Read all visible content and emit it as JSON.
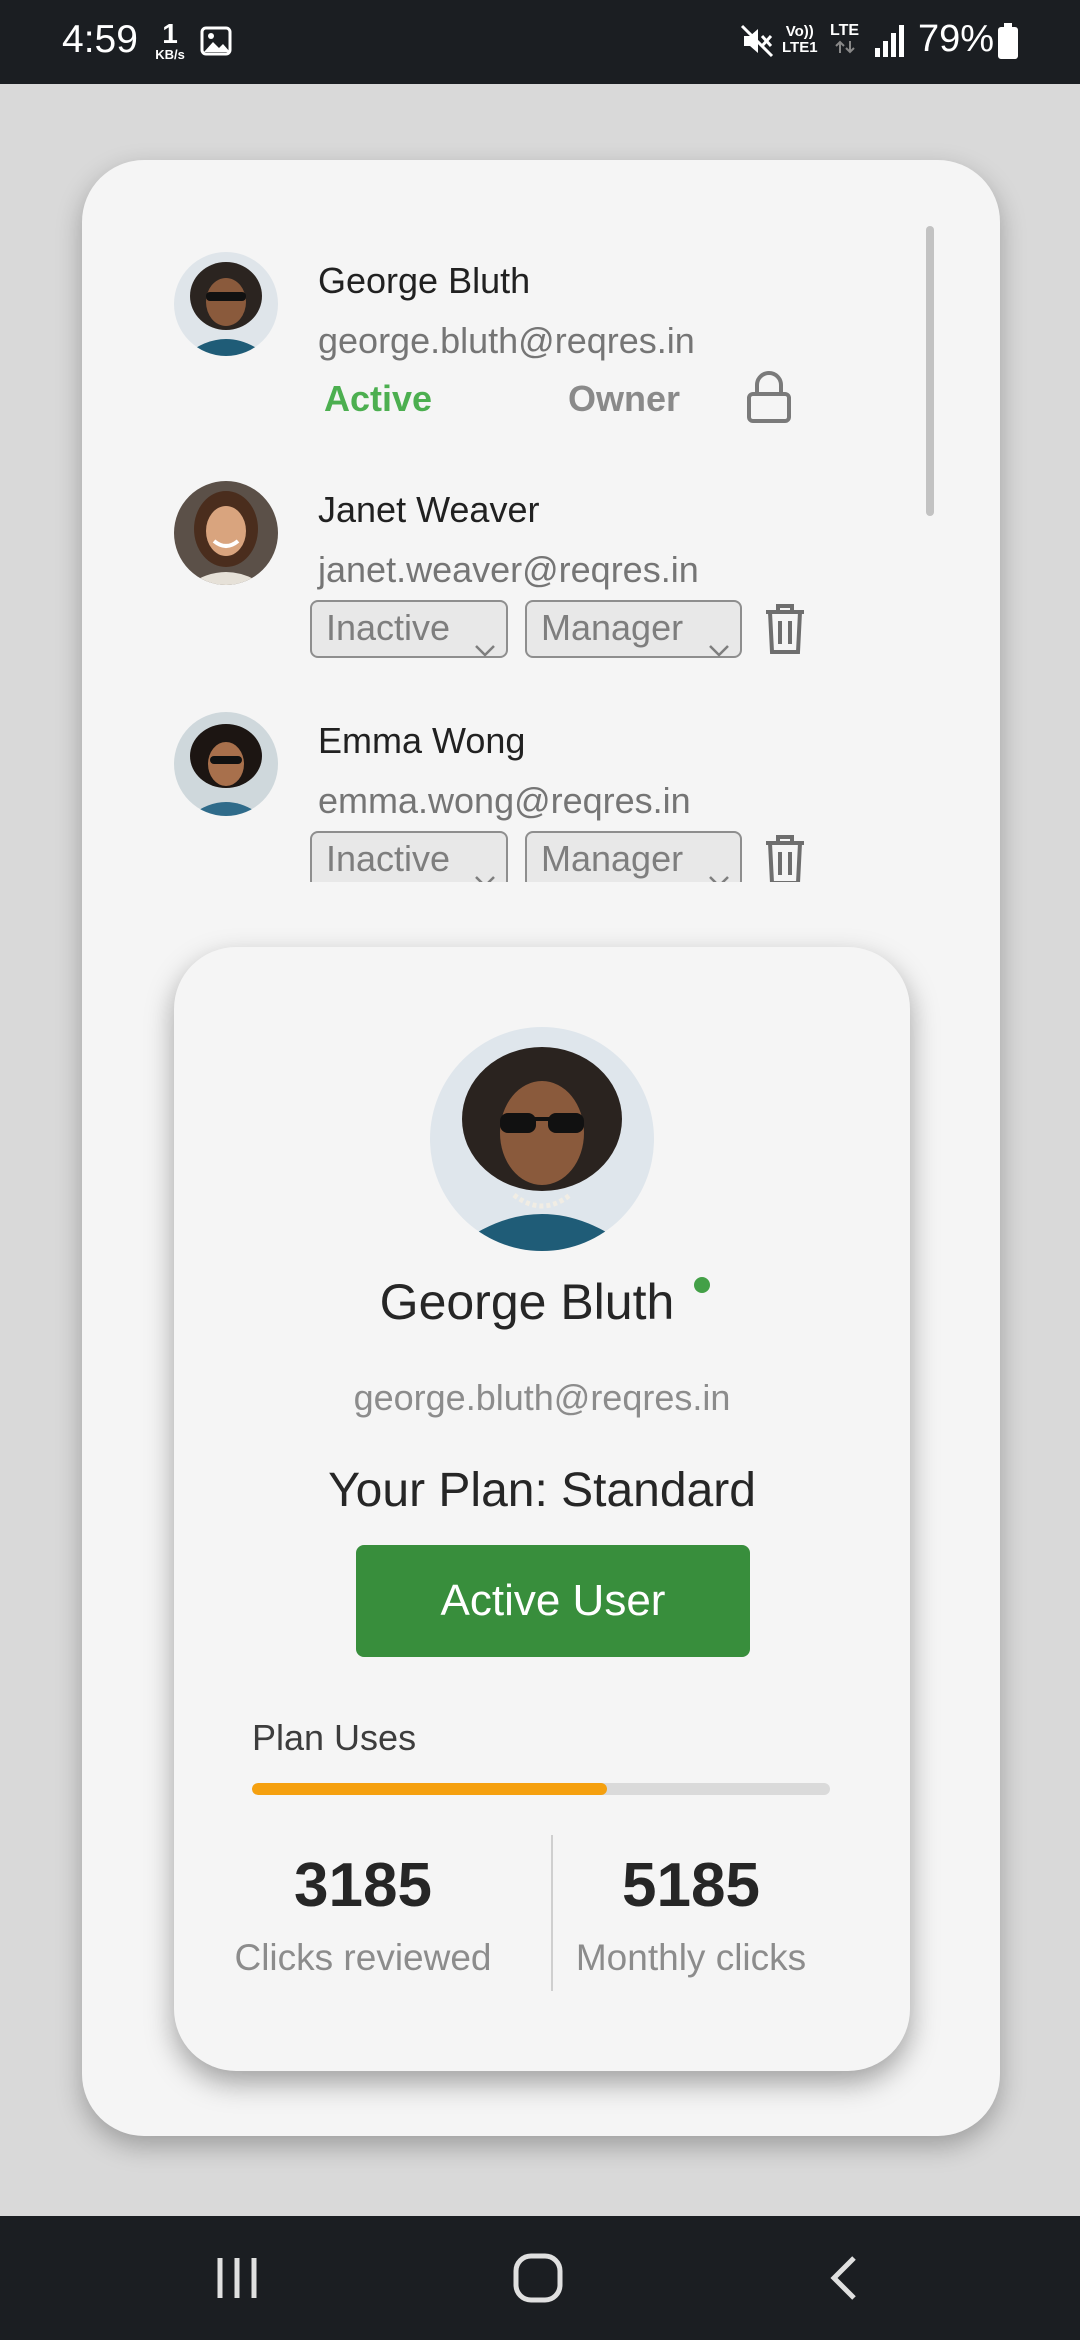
{
  "status_bar": {
    "time": "4:59",
    "net_speed_value": "1",
    "net_speed_unit": "KB/s",
    "volte_line1": "Vo))",
    "volte_line2": "LTE1",
    "lte": "LTE",
    "battery": "79%",
    "icons": [
      "image-icon",
      "mute-icon",
      "signal-icon",
      "battery-icon"
    ]
  },
  "users": [
    {
      "name": "George Bluth",
      "email": "george.bluth@reqres.in",
      "status": "Active",
      "role": "Owner",
      "action_icon": "lock-icon"
    },
    {
      "name": "Janet Weaver",
      "email": "janet.weaver@reqres.in",
      "status": "Inactive",
      "role": "Manager",
      "action_icon": "trash-icon"
    },
    {
      "name": "Emma Wong",
      "email": "emma.wong@reqres.in",
      "status": "Inactive",
      "role": "Manager",
      "action_icon": "trash-icon"
    }
  ],
  "profile": {
    "name": "George Bluth",
    "email": "george.bluth@reqres.in",
    "plan": "Your Plan: Standard",
    "button_label": "Active User",
    "uses_label": "Plan Uses",
    "uses_fraction": 0.614,
    "stats": {
      "left_value": "3185",
      "left_label": "Clicks reviewed",
      "right_value": "5185",
      "right_label": "Monthly clicks"
    }
  },
  "colors": {
    "active_status": "#4caf50",
    "button": "#388e3c",
    "progress": "#f5a00f",
    "online_dot": "#43a047"
  },
  "nav": [
    "recents-icon",
    "home-icon",
    "back-icon"
  ]
}
